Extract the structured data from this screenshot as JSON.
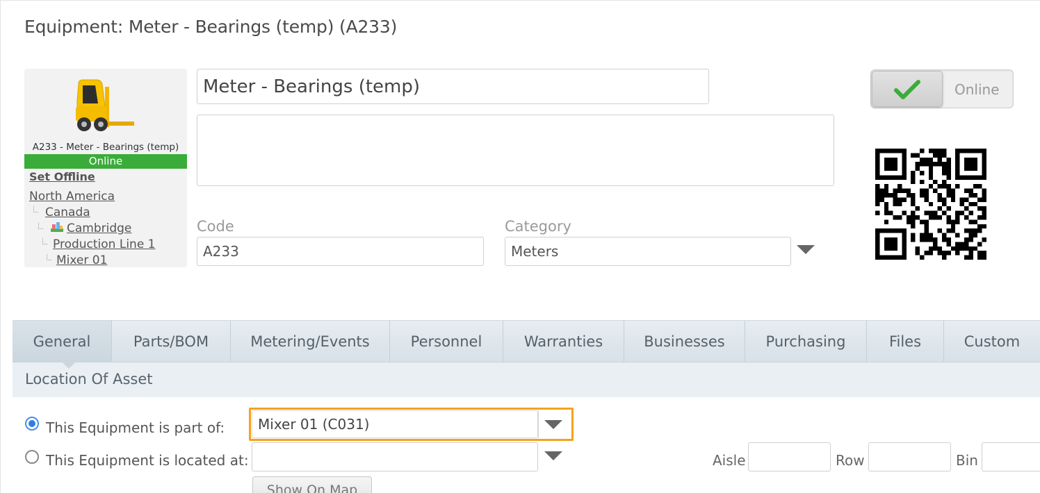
{
  "page": {
    "title": "Equipment: Meter - Bearings (temp) (A233)"
  },
  "asset_card": {
    "icon": "forklift-icon",
    "caption": "A233 - Meter - Bearings (temp)",
    "status": "Online",
    "status_color": "#3aac3a",
    "set_offline_label": "Set Offline",
    "location_tree": [
      {
        "label": "North America",
        "level": 0
      },
      {
        "label": "Canada",
        "level": 1
      },
      {
        "label": "Cambridge",
        "level": 2,
        "icon": "facility-icon"
      },
      {
        "label": "Production Line 1",
        "level": 3
      },
      {
        "label": "Mixer 01",
        "level": 4
      }
    ]
  },
  "form": {
    "name_value": "Meter - Bearings (temp)",
    "description_value": "",
    "code_label": "Code",
    "code_value": "A233",
    "category_label": "Category",
    "category_value": "Meters"
  },
  "status_toggle": {
    "label": "Online",
    "icon": "checkmark-icon",
    "check_color": "#3aac3a"
  },
  "qr": {
    "icon": "qr-code-icon"
  },
  "tabs": [
    {
      "label": "General",
      "active": true
    },
    {
      "label": "Parts/BOM"
    },
    {
      "label": "Metering/Events"
    },
    {
      "label": "Personnel"
    },
    {
      "label": "Warranties"
    },
    {
      "label": "Businesses"
    },
    {
      "label": "Purchasing"
    },
    {
      "label": "Files"
    },
    {
      "label": "Custom"
    }
  ],
  "location_section": {
    "title": "Location Of Asset",
    "part_of_label": "This Equipment is part of:",
    "part_of_value": "Mixer 01 (C031)",
    "part_of_selected": true,
    "located_at_label": "This Equipment is located at:",
    "located_at_value": "",
    "aisle_label": "Aisle",
    "row_label": "Row",
    "bin_label": "Bin",
    "show_on_map_label": "Show On Map",
    "highlight_color": "#f5a21b"
  }
}
